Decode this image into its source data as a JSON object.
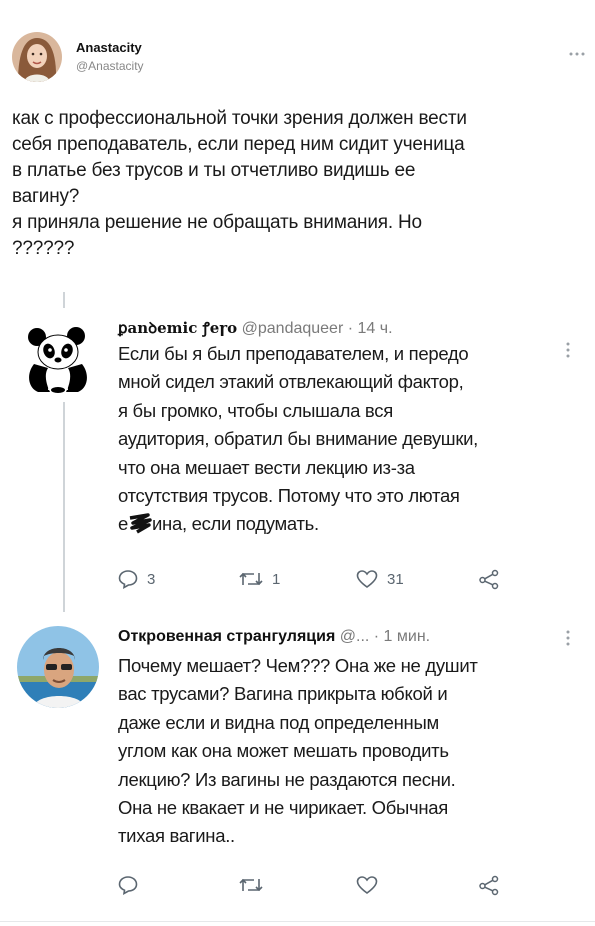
{
  "main_tweet": {
    "author_name": "Anastacity",
    "author_handle": "@Anastacity",
    "text_lines": [
      "как с профессиональной точки зрения должен вести",
      "себя преподаватель, если перед ним сидит ученица",
      "в платье без трусов и ты отчетливо видишь ее",
      "вагину?",
      "я приняла решение не обращать внимания. Но",
      "??????"
    ]
  },
  "reply1": {
    "author_name": "ꝑanꝺemic ꝭeꞅo",
    "author_handle": "@pandaqueer",
    "time": "· 14 ч.",
    "text_lines": [
      "Если бы я был преподавателем, и передо",
      "мной сидел этакий отвлекающий фактор,",
      "я бы громко, чтобы слышала вся",
      "аудитория, обратил бы внимание девушки,",
      "что она мешает вести лекцию из-за",
      "отсутствия трусов. Потому что это лютая"
    ],
    "last_line_start": "е",
    "last_line_end": "ина, если подумать.",
    "actions": {
      "replies": "3",
      "retweets": "1",
      "likes": "31"
    }
  },
  "reply2": {
    "author_name": "Откровенная странгуляция",
    "author_handle": "@...",
    "time": "· 1 мин.",
    "text_lines": [
      "Почему мешает? Чем??? Она же не душит",
      "вас трусами? Вагина прикрыта юбкой и",
      "даже если и видна под определенным",
      "углом как она может мешать проводить",
      "лекцию? Из вагины не раздаются песни.",
      "Она не квакает и не чирикает. Обычная",
      "тихая вагина.."
    ]
  },
  "colors": {
    "text": "#1a1a1a",
    "secondary": "#7a7a7a",
    "icon": "#5b6670",
    "thread_line": "#cfd4d8"
  }
}
